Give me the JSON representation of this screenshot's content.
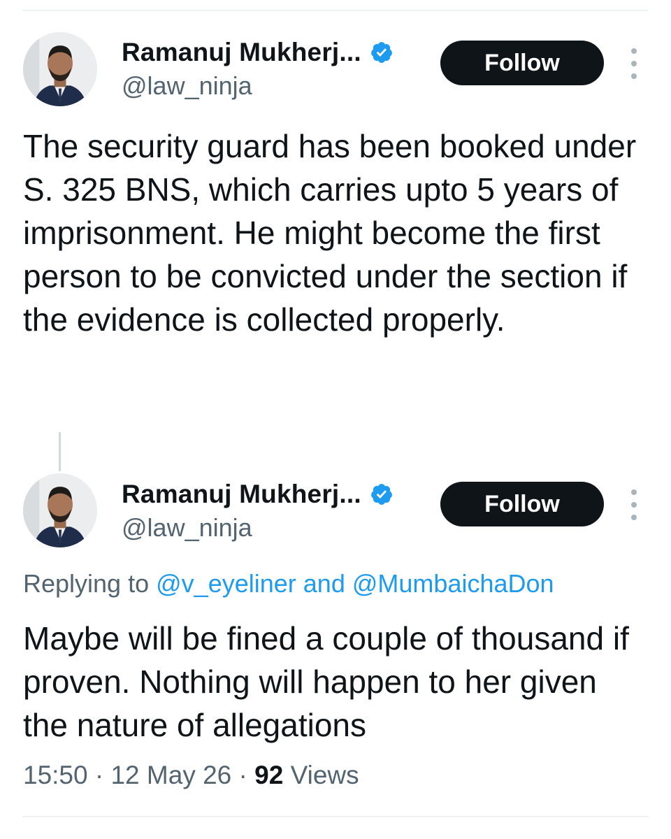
{
  "tweets": [
    {
      "author": {
        "name": "Ramanuj Mukherj...",
        "handle": "@law_ninja"
      },
      "follow_label": "Follow",
      "text": "The security guard has been booked under S. 325 BNS, which carries upto 5 years of imprisonment. He might become the first person to be convicted under the section if the evidence is collected properly."
    },
    {
      "author": {
        "name": "Ramanuj Mukherj...",
        "handle": "@law_ninja"
      },
      "follow_label": "Follow",
      "replying": {
        "prefix": "Replying to",
        "mention1": "@v_eyeliner",
        "conjunction": "and",
        "mention2": "@MumbaichaDon"
      },
      "text": "Maybe will be fined a couple of thousand if proven. Nothing will happen to her given the nature of allegations",
      "meta": {
        "time": "15:50",
        "separator": "·",
        "date": "12 May 26",
        "views_count": "92",
        "views_label": "Views"
      }
    }
  ],
  "icons": {
    "verified": "verified-badge-icon",
    "more": "more-options-icon"
  },
  "colors": {
    "accent": "#1d9bf0",
    "text": "#0f1419",
    "secondary": "#536471",
    "button": "#0f1419"
  }
}
